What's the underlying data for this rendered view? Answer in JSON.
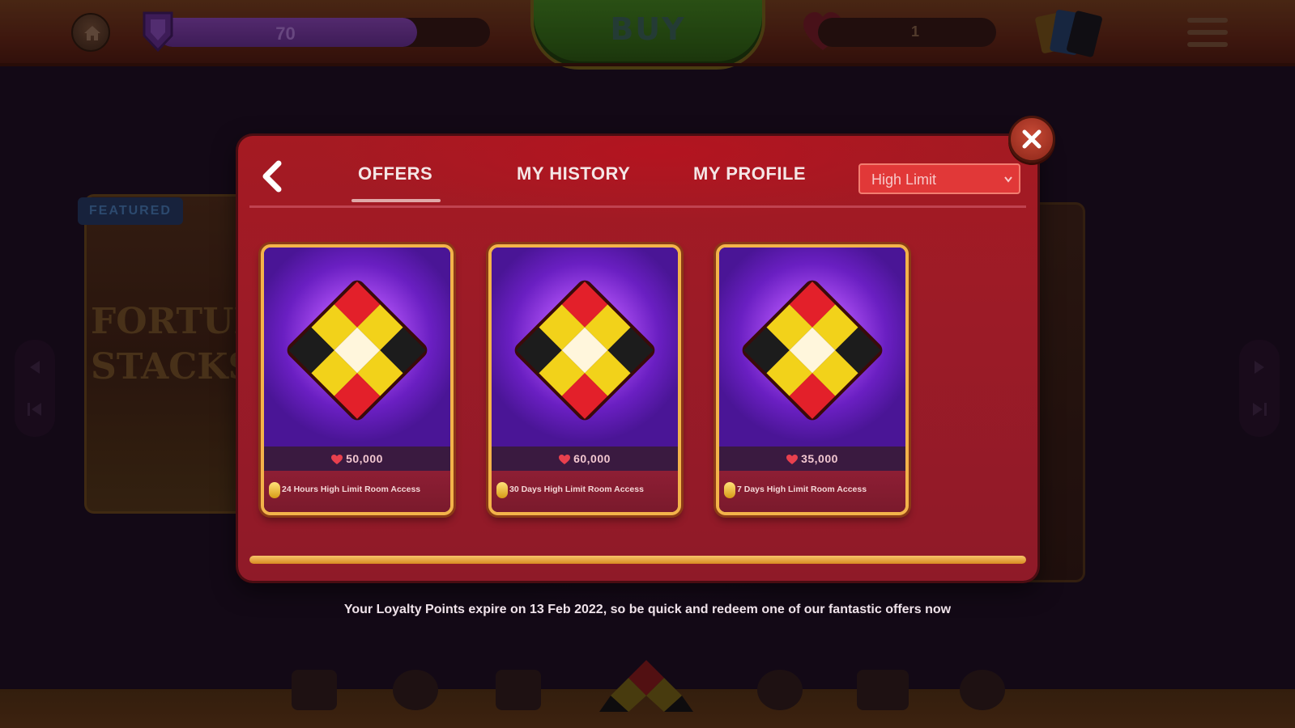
{
  "topbar": {
    "level_value": "70",
    "level_progress": 0.78,
    "buy_label": "BUY",
    "hearts_value": "1"
  },
  "background": {
    "featured_badge": "FEATURED",
    "featured_title": "FORTUNE STACKS"
  },
  "dialog": {
    "tabs": [
      {
        "label": "OFFERS",
        "active": true
      },
      {
        "label": "MY HISTORY",
        "active": false
      },
      {
        "label": "MY PROFILE",
        "active": false
      }
    ],
    "category_select": {
      "value": "High Limit"
    },
    "offers": [
      {
        "price": "50,000",
        "description": "24 Hours High Limit Room Access"
      },
      {
        "price": "60,000",
        "description": "30 Days High Limit Room Access"
      },
      {
        "price": "35,000",
        "description": "7 Days High Limit Room Access"
      }
    ],
    "scroll_progress": 1.0
  },
  "expire_note": "Your Loyalty Points expire on 13 Feb 2022, so be quick and redeem one of our fantastic offers now",
  "colors": {
    "dialog_red": "#9c1b27",
    "card_border": "#f3b34a",
    "card_purple": "#a84cf0",
    "select_red": "#e13838"
  }
}
